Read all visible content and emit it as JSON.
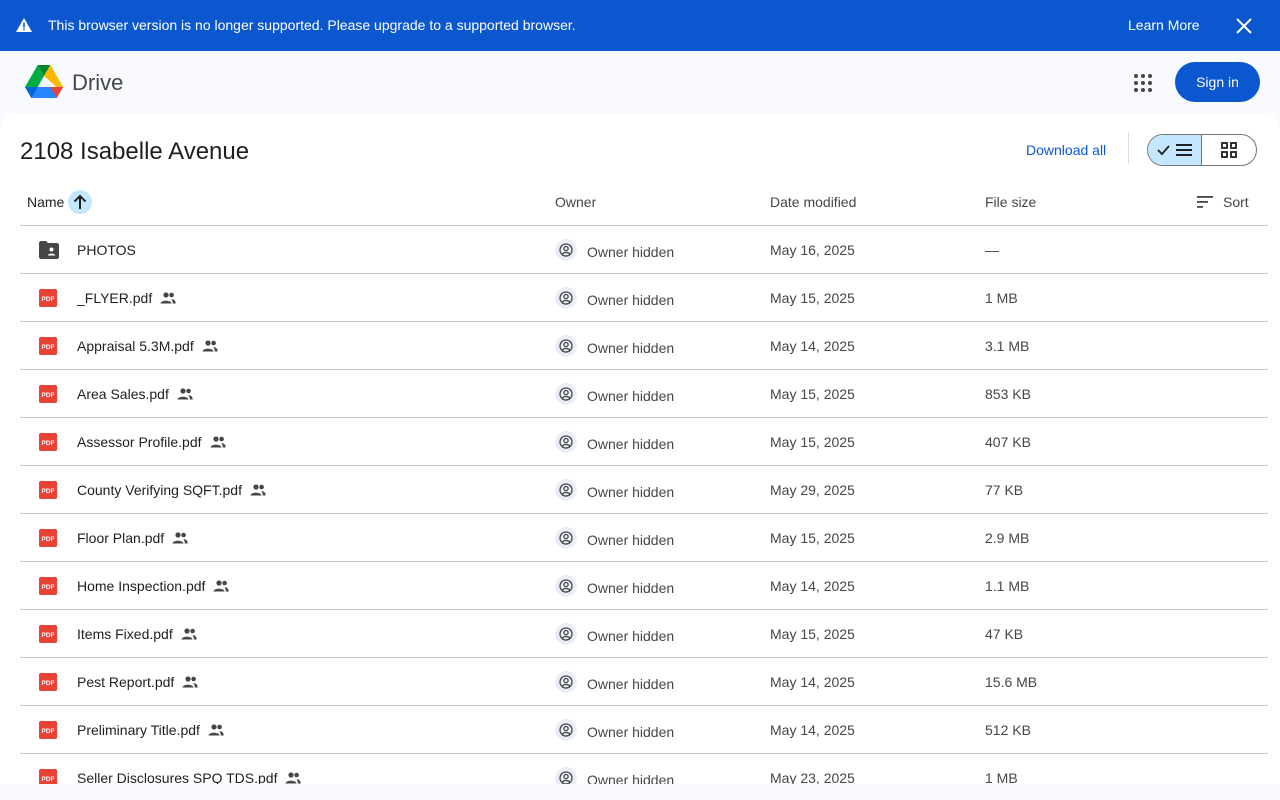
{
  "banner": {
    "message": "This browser version is no longer supported. Please upgrade to a supported browser.",
    "learn_more": "Learn More",
    "warning_icon": "warning-icon",
    "close_icon": "close-icon"
  },
  "header": {
    "brand": "Drive",
    "logo_icon": "google-drive-logo",
    "apps_icon": "apps-grid-icon",
    "sign_in": "Sign in"
  },
  "folder": {
    "title": "2108 Isabelle Avenue",
    "download_all": "Download all",
    "view": "list"
  },
  "columns": {
    "name": "Name",
    "owner": "Owner",
    "date_modified": "Date modified",
    "file_size": "File size",
    "sort": "Sort"
  },
  "colors": {
    "accent": "#0b57d0",
    "selected": "#c2e7ff",
    "pdf": "#ea4335"
  },
  "files": [
    {
      "type": "folder",
      "name": "PHOTOS",
      "shared": false,
      "owner": "Owner hidden",
      "date": "May 16, 2025",
      "size": "—"
    },
    {
      "type": "pdf",
      "name": "_FLYER.pdf",
      "shared": true,
      "owner": "Owner hidden",
      "date": "May 15, 2025",
      "size": "1 MB"
    },
    {
      "type": "pdf",
      "name": "Appraisal 5.3M.pdf",
      "shared": true,
      "owner": "Owner hidden",
      "date": "May 14, 2025",
      "size": "3.1 MB"
    },
    {
      "type": "pdf",
      "name": "Area Sales.pdf",
      "shared": true,
      "owner": "Owner hidden",
      "date": "May 15, 2025",
      "size": "853 KB"
    },
    {
      "type": "pdf",
      "name": "Assessor Profile.pdf",
      "shared": true,
      "owner": "Owner hidden",
      "date": "May 15, 2025",
      "size": "407 KB"
    },
    {
      "type": "pdf",
      "name": "County Verifying SQFT.pdf",
      "shared": true,
      "owner": "Owner hidden",
      "date": "May 29, 2025",
      "size": "77 KB"
    },
    {
      "type": "pdf",
      "name": "Floor Plan.pdf",
      "shared": true,
      "owner": "Owner hidden",
      "date": "May 15, 2025",
      "size": "2.9 MB"
    },
    {
      "type": "pdf",
      "name": "Home Inspection.pdf",
      "shared": true,
      "owner": "Owner hidden",
      "date": "May 14, 2025",
      "size": "1.1 MB"
    },
    {
      "type": "pdf",
      "name": "Items Fixed.pdf",
      "shared": true,
      "owner": "Owner hidden",
      "date": "May 15, 2025",
      "size": "47 KB"
    },
    {
      "type": "pdf",
      "name": "Pest Report.pdf",
      "shared": true,
      "owner": "Owner hidden",
      "date": "May 14, 2025",
      "size": "15.6 MB"
    },
    {
      "type": "pdf",
      "name": "Preliminary Title.pdf",
      "shared": true,
      "owner": "Owner hidden",
      "date": "May 14, 2025",
      "size": "512 KB"
    },
    {
      "type": "pdf",
      "name": "Seller Disclosures SPQ TDS.pdf",
      "shared": true,
      "owner": "Owner hidden",
      "date": "May 23, 2025",
      "size": "1 MB"
    }
  ]
}
